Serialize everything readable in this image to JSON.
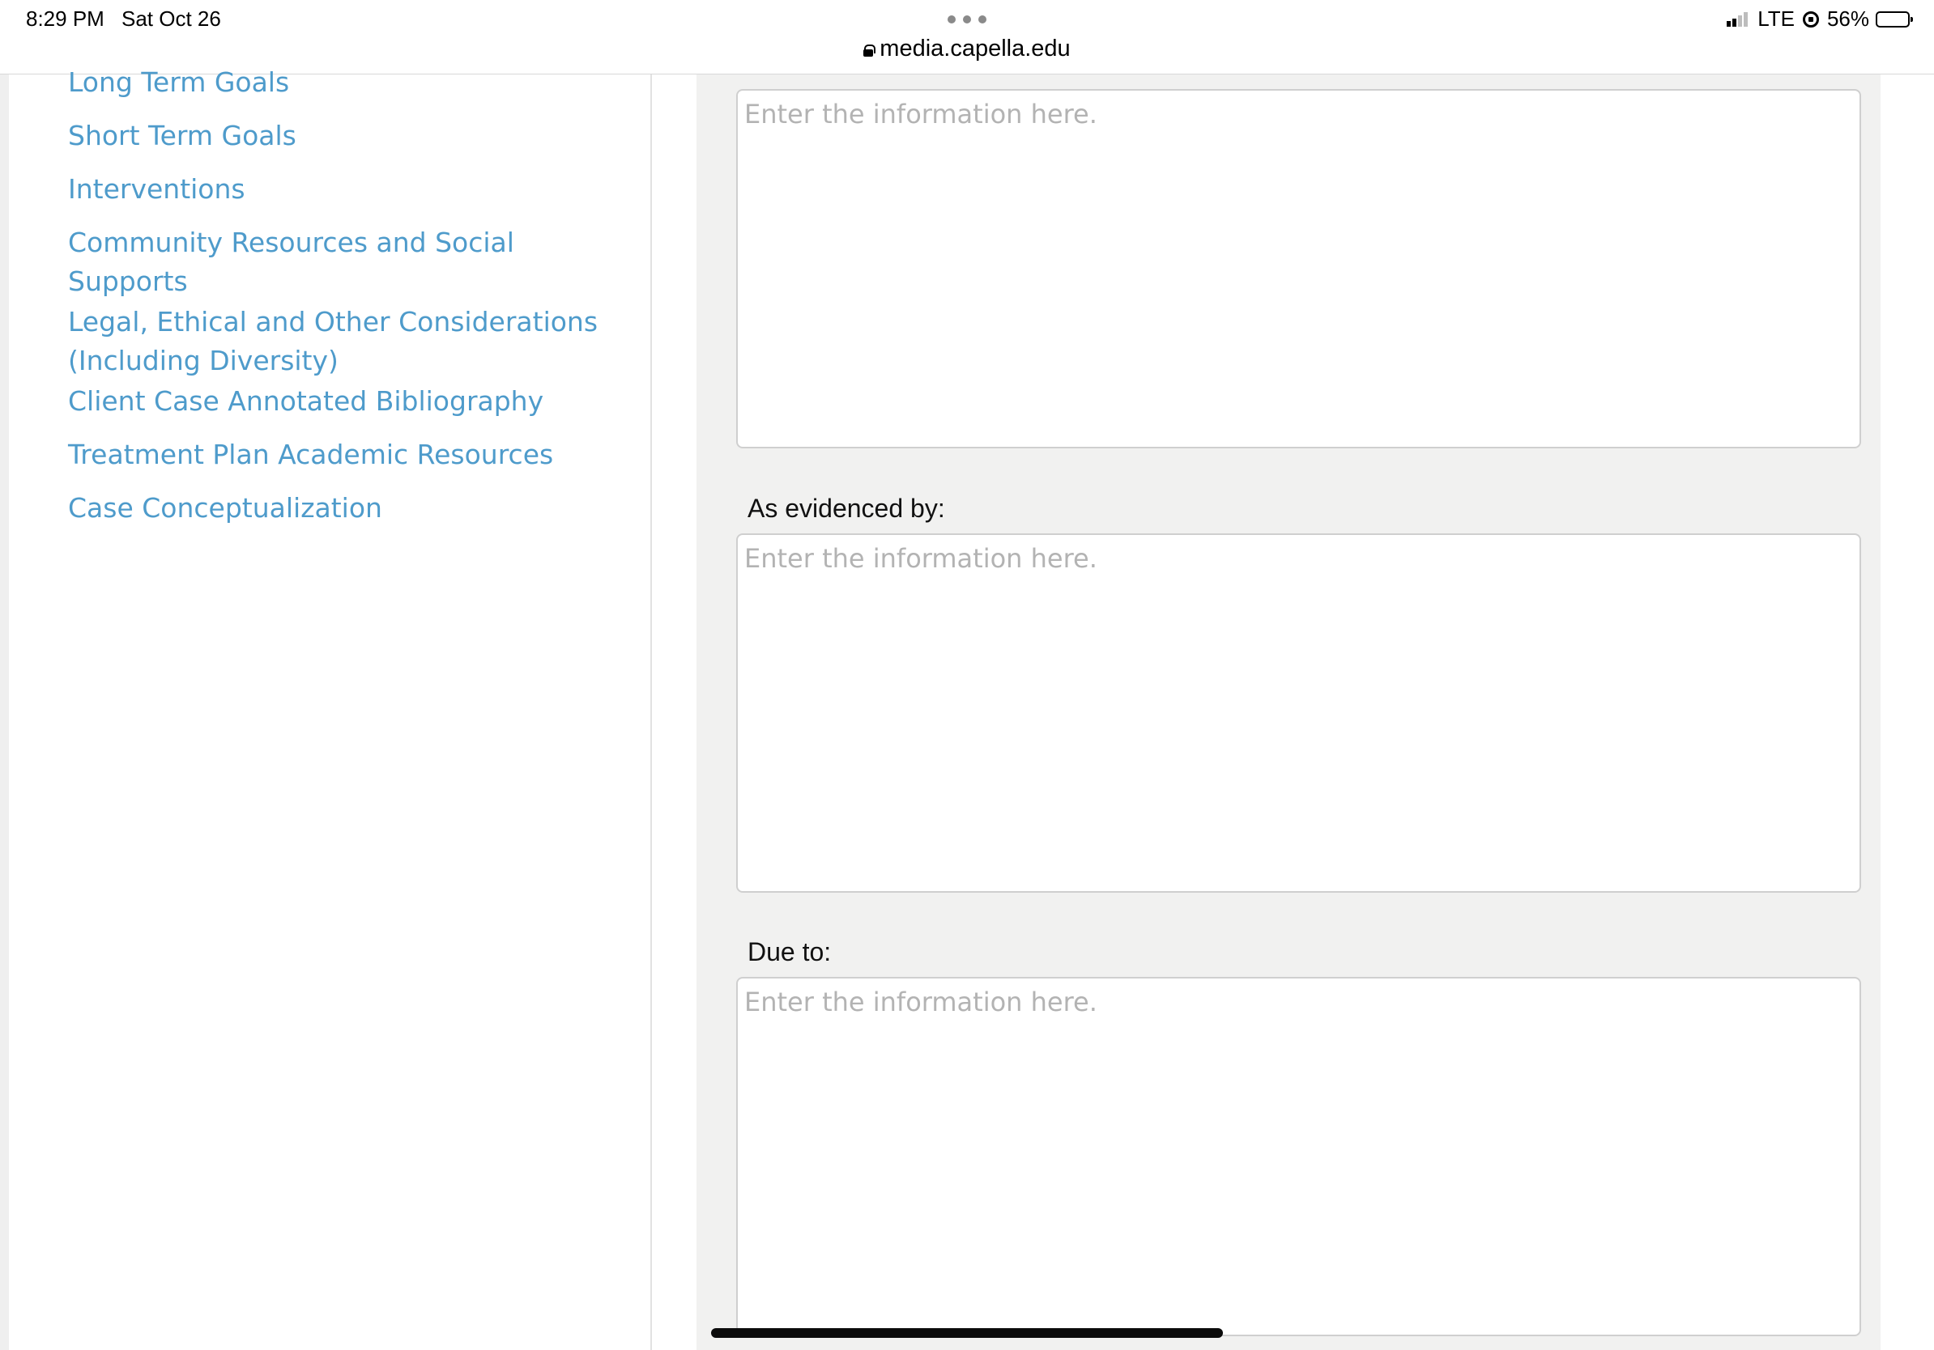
{
  "status_bar": {
    "time": "8:29 PM",
    "date": "Sat Oct 26",
    "url": "media.capella.edu",
    "network": "LTE",
    "battery_percent_label": "56%",
    "battery_level": 0.56,
    "icons": [
      "more-dots-icon",
      "lock-icon",
      "signal-icon",
      "rotation-lock-icon",
      "battery-icon"
    ]
  },
  "sidebar": {
    "items": [
      {
        "label": "Long Term Goals"
      },
      {
        "label": "Short Term Goals"
      },
      {
        "label": "Interventions"
      },
      {
        "label": "Community Resources and Social Supports"
      },
      {
        "label": "Legal, Ethical and Other Considerations (Including Diversity)"
      },
      {
        "label": "Client Case Annotated Bibliography"
      },
      {
        "label": "Treatment Plan Academic Resources"
      },
      {
        "label": "Case Conceptualization"
      }
    ]
  },
  "form": {
    "fields": [
      {
        "label": "",
        "placeholder": "Enter the information here.",
        "value": ""
      },
      {
        "label": "As evidenced by:",
        "placeholder": "Enter the information here.",
        "value": ""
      },
      {
        "label": "Due to:",
        "placeholder": "Enter the information here.",
        "value": ""
      }
    ]
  },
  "colors": {
    "link": "#4e9bcb",
    "content_bg": "#f1f1f0",
    "placeholder": "#b3b3b3",
    "textarea_border": "#cfcfcf"
  }
}
